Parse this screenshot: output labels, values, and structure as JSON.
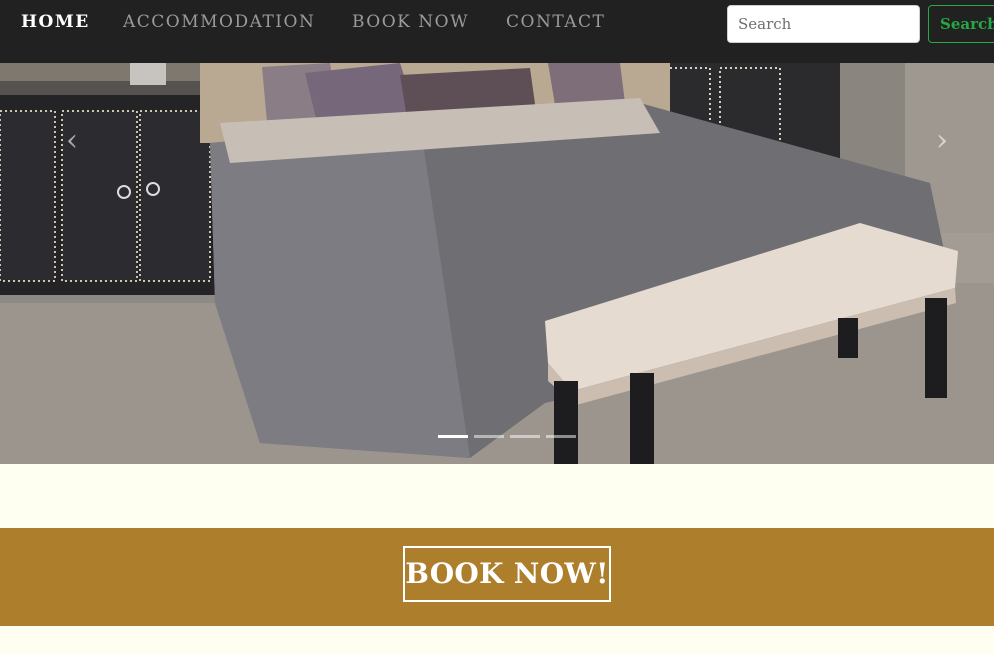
{
  "nav": {
    "items": [
      {
        "label": "HOME",
        "active": true
      },
      {
        "label": "ACCOMMODATION",
        "active": false
      },
      {
        "label": "BOOK NOW",
        "active": false
      },
      {
        "label": "CONTACT",
        "active": false
      }
    ],
    "search": {
      "placeholder": "Search",
      "button_label": "Search"
    }
  },
  "carousel": {
    "image": "bedroom-with-tufted-bench",
    "prev_icon": "chevron-left-icon",
    "next_icon": "chevron-right-icon",
    "slide_count": 4,
    "active_slide": 1
  },
  "cta": {
    "label": "BOOK NOW!"
  },
  "colors": {
    "nav_bg": "#212121",
    "page_bg": "#fffff1",
    "cta_bg": "#ad7e2c",
    "search_accent": "#28a745"
  }
}
